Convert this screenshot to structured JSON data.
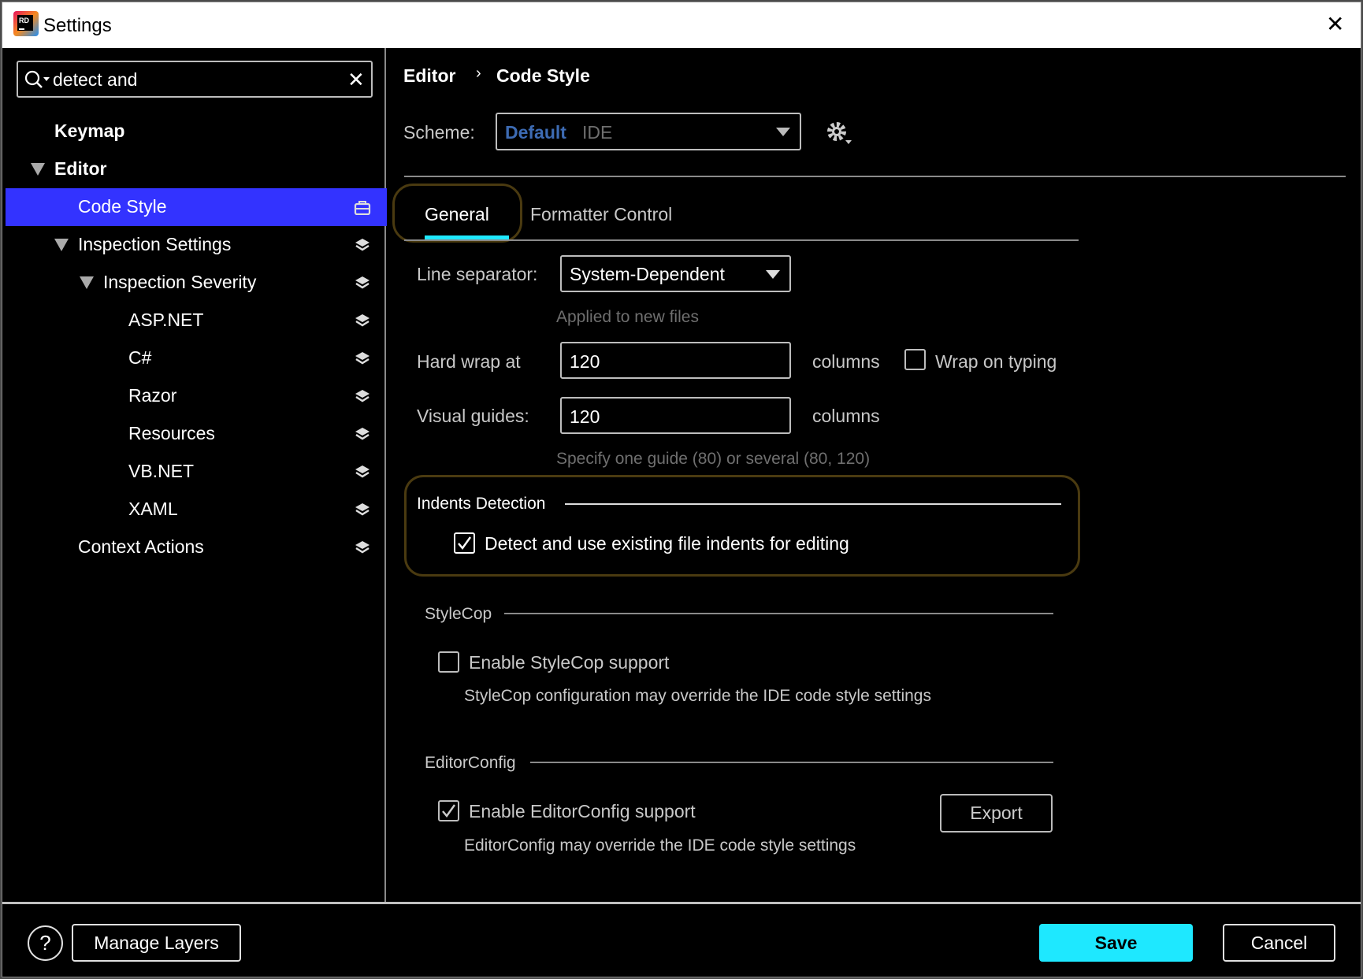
{
  "window": {
    "title": "Settings",
    "close_label": "✕"
  },
  "search": {
    "value": "detect and"
  },
  "tree": [
    {
      "label": "Keymap"
    },
    {
      "label": "Editor"
    },
    {
      "label": "Code Style"
    },
    {
      "label": "Inspection Settings"
    },
    {
      "label": "Inspection Severity"
    },
    {
      "label": "ASP.NET"
    },
    {
      "label": "C#"
    },
    {
      "label": "Razor"
    },
    {
      "label": "Resources"
    },
    {
      "label": "VB.NET"
    },
    {
      "label": "XAML"
    },
    {
      "label": "Context Actions"
    }
  ],
  "breadcrumb": {
    "parent": "Editor",
    "separator": "›",
    "current": "Code Style"
  },
  "scheme": {
    "label": "Scheme:",
    "name": "Default",
    "type": "IDE"
  },
  "tabs": [
    {
      "label": "General",
      "active": true
    },
    {
      "label": "Formatter Control",
      "active": false
    }
  ],
  "general": {
    "line_separator_label": "Line separator:",
    "line_separator_value": "System-Dependent",
    "line_separator_hint": "Applied to new files",
    "hard_wrap_label": "Hard wrap at",
    "hard_wrap_value": "120",
    "columns_label": "columns",
    "wrap_on_typing_label": "Wrap on typing",
    "wrap_on_typing_checked": false,
    "visual_guides_label": "Visual guides:",
    "visual_guides_value": "120",
    "visual_guides_hint": "Specify one guide (80) or several (80, 120)"
  },
  "indents": {
    "title": "Indents Detection",
    "checkbox_label": "Detect and use existing file indents for editing",
    "checked": true
  },
  "stylecop": {
    "title": "StyleCop",
    "checkbox_label": "Enable StyleCop support",
    "checked": false,
    "hint": "StyleCop configuration may override the IDE code style settings"
  },
  "editorconfig": {
    "title": "EditorConfig",
    "checkbox_label": "Enable EditorConfig support",
    "checked": true,
    "hint": "EditorConfig may override the IDE code style settings",
    "export_label": "Export"
  },
  "footer": {
    "help_label": "?",
    "manage_layers_label": "Manage Layers",
    "save_label": "Save",
    "cancel_label": "Cancel"
  },
  "colors": {
    "selection": "#3333ff",
    "accent": "#1ee8ff",
    "scheme_name": "#3d6bb3"
  }
}
